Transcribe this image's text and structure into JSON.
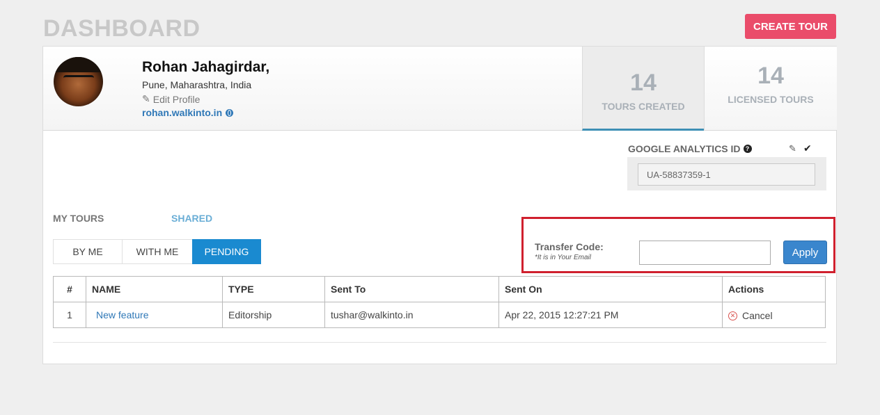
{
  "page": {
    "title": "DASHBOARD",
    "create_button": "CREATE TOUR"
  },
  "profile": {
    "name": "Rohan Jahagirdar,",
    "location": "Pune, Maharashtra, India",
    "edit_label": "Edit Profile",
    "website": "rohan.walkinto.in"
  },
  "stats": {
    "tours_created": {
      "value": "14",
      "label": "TOURS CREATED"
    },
    "licensed_tours": {
      "value": "14",
      "label": "LICENSED TOURS"
    }
  },
  "analytics": {
    "label": "GOOGLE ANALYTICS ID",
    "value": "UA-58837359-1"
  },
  "sections": {
    "my_tours": "MY TOURS",
    "shared": "SHARED"
  },
  "tabs": [
    {
      "label": "BY ME",
      "active": false
    },
    {
      "label": "WITH ME",
      "active": false
    },
    {
      "label": "PENDING",
      "active": true
    }
  ],
  "transfer": {
    "label": "Transfer Code:",
    "hint": "*It is in Your Email",
    "value": "",
    "apply_label": "Apply"
  },
  "table": {
    "headers": [
      "#",
      "NAME",
      "TYPE",
      "Sent To",
      "Sent On",
      "Actions"
    ],
    "rows": [
      {
        "num": "1",
        "name": "New feature",
        "type": "Editorship",
        "sent_to": "tushar@walkinto.in",
        "sent_on": "Apr 22, 2015 12:27:21 PM",
        "action": "Cancel"
      }
    ]
  },
  "colors": {
    "accent": "#1a8ad0",
    "create": "#ea4c6a",
    "highlight": "#d0202e",
    "link": "#2f78b7"
  }
}
